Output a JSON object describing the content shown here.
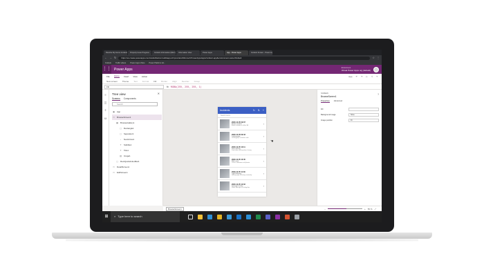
{
  "browser": {
    "tabs": [
      {
        "label": "Resolve My Home Incidents",
        "active": false
      },
      {
        "label": "Property Issue Progress",
        "active": false
      },
      {
        "label": "Incident Information (DEV)",
        "active": false
      },
      {
        "label": "Information View",
        "active": false
      },
      {
        "label": "Power Apps",
        "active": false
      },
      {
        "label": "App - Power Apps",
        "active": true
      },
      {
        "label": "Incident Screen - Power Apps",
        "active": false
      }
    ],
    "url": "https://us.create.powerapps.com/studio/#action=edit&app-id=/providers/Microsoft.PowerApps/apps/incident-app&environment-name=Default",
    "bookmarks": [
      "Outlook",
      "Traffic videos",
      "Power Apps Video",
      "Power Platform Ad..."
    ]
  },
  "powerapps": {
    "app_name": "Power Apps",
    "env_label": "Environment",
    "env_name": "Virtual Power Apps org (default)"
  },
  "menu": {
    "items": [
      "File",
      "Home",
      "Insert",
      "View",
      "Action"
    ],
    "active": "Home",
    "right": [
      "App",
      "Undo",
      "Redo",
      "Run",
      "Share",
      "Help"
    ]
  },
  "ribbon": {
    "items": [
      "New screen",
      "Theme",
      "Text",
      "Format",
      "Fill",
      "Border",
      "Align",
      "Reorder",
      "Group"
    ]
  },
  "formula_bar": {
    "property": "Fill",
    "fx": "fx",
    "formula": "RGBA(255, 255, 255, 1)"
  },
  "tree_view": {
    "title": "Tree view",
    "tabs": [
      "Screens",
      "Components"
    ],
    "search_placeholder": "Search",
    "items": [
      {
        "label": "App",
        "icon": "app-icon",
        "indent": 0
      },
      {
        "label": "BrowseScreen1",
        "icon": "screen-icon",
        "indent": 0,
        "selected": true
      },
      {
        "label": "BrowseGallery1",
        "icon": "gallery-icon",
        "indent": 1
      },
      {
        "label": "Rectangle1",
        "icon": "rect-icon",
        "indent": 2
      },
      {
        "label": "Separator1",
        "icon": "rect-icon",
        "indent": 2
      },
      {
        "label": "NextArrow1",
        "icon": "arrow-icon",
        "indent": 2
      },
      {
        "label": "Subtitle1",
        "icon": "label-icon",
        "indent": 2
      },
      {
        "label": "Title1",
        "icon": "label-icon",
        "indent": 2
      },
      {
        "label": "Image1",
        "icon": "image-icon",
        "indent": 2
      },
      {
        "label": "RectQuickActionBar1",
        "icon": "rect-icon",
        "indent": 1
      },
      {
        "label": "DetailScreen1",
        "icon": "screen-icon",
        "indent": 0
      },
      {
        "label": "EditScreen1",
        "icon": "screen-icon",
        "indent": 0
      }
    ]
  },
  "phone": {
    "title": "Incidents",
    "search_placeholder": "Search items",
    "gallery": [
      {
        "date": "2020-12-05 09:07",
        "title": "Broken window",
        "desc": "Broken window in office 3A"
      },
      {
        "date": "2020-12-05 09:43",
        "title": "Leaking pipe",
        "desc": "Leaking pipe in kitchen sink"
      },
      {
        "date": "2020-12-05 10:11",
        "title": "Door sticking",
        "desc": "Front door sticking when closing"
      },
      {
        "date": "2020-12-05 10:45",
        "title": "Wall crack",
        "desc": "Crack in bedroom wall plaster"
      },
      {
        "date": "2020-12-05 11:30",
        "title": "Light flickering",
        "desc": "Hallway light flickering constantly"
      },
      {
        "date": "2020-12-05 12:02",
        "title": "Damaged ceiling",
        "desc": "Water damage on ceiling tiles"
      }
    ]
  },
  "properties": {
    "type": "SCREEN",
    "name": "BrowseScreen1",
    "tabs": [
      "Properties",
      "Advanced"
    ],
    "rows": [
      {
        "label": "Fill",
        "value": ""
      },
      {
        "label": "Background image",
        "value": "None"
      },
      {
        "label": "Image position",
        "value": "Fit"
      }
    ]
  },
  "status": {
    "screen": "BrowseScreen1",
    "zoom_fraction": 0.55,
    "zoom_text": "55 %"
  },
  "taskbar": {
    "search_placeholder": "Type here to search",
    "apps": [
      {
        "name": "task-view-icon",
        "color": "#1f1f1f"
      },
      {
        "name": "file-explorer-icon",
        "color": "#f3c13a"
      },
      {
        "name": "edge-icon",
        "color": "#2e8fd6"
      },
      {
        "name": "chrome-icon",
        "color": "#e4b424"
      },
      {
        "name": "ie-icon",
        "color": "#3a9ad9"
      },
      {
        "name": "mail-icon",
        "color": "#1a73c7"
      },
      {
        "name": "vscode-icon",
        "color": "#2b8fd6"
      },
      {
        "name": "excel-icon",
        "color": "#1f8a4c"
      },
      {
        "name": "teams-icon",
        "color": "#5b5fc7"
      },
      {
        "name": "onenote-icon",
        "color": "#8a2fa3"
      },
      {
        "name": "powerpoint-icon",
        "color": "#d35230"
      },
      {
        "name": "settings-icon",
        "color": "#9aa0a6"
      }
    ]
  }
}
